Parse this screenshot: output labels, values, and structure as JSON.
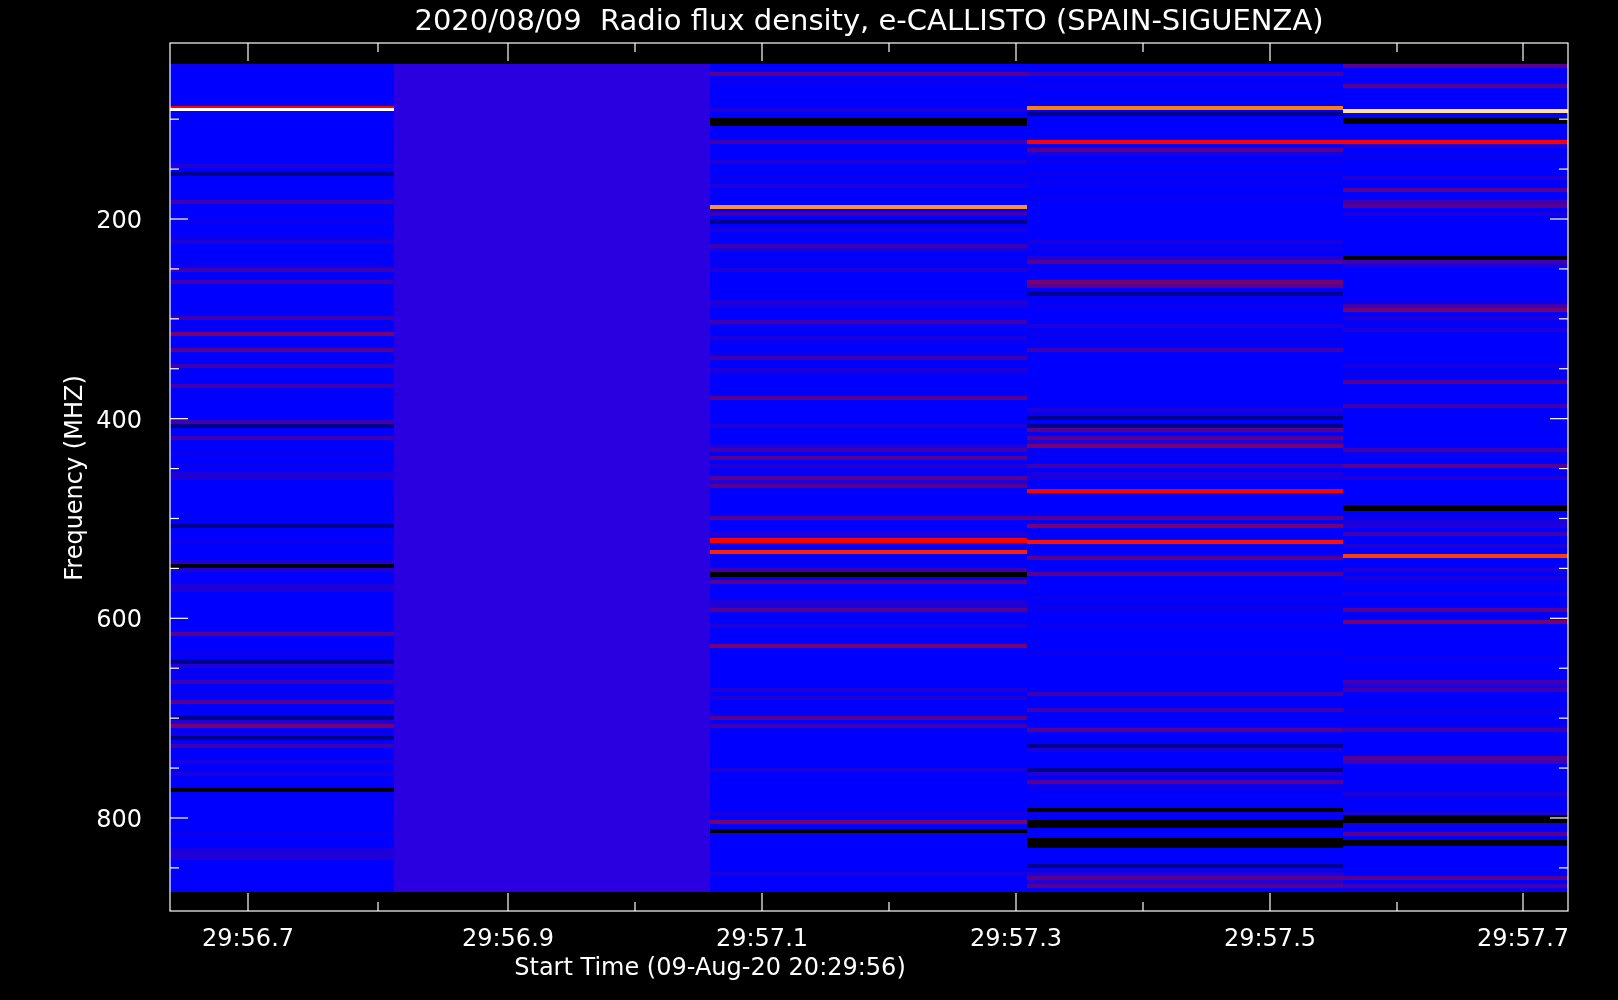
{
  "title": "2020/08/09  Radio flux density, e-CALLISTO (SPAIN-SIGUENZA)",
  "y_axis": {
    "label": "Frequency (MHZ)",
    "ticks": [
      "200",
      "400",
      "600",
      "800"
    ]
  },
  "x_axis": {
    "label": "Start Time (09-Aug-20 20:29:56)",
    "ticks": [
      "29:56.7",
      "29:56.9",
      "29:57.1",
      "29:57.3",
      "29:57.5",
      "29:57.7"
    ]
  }
}
